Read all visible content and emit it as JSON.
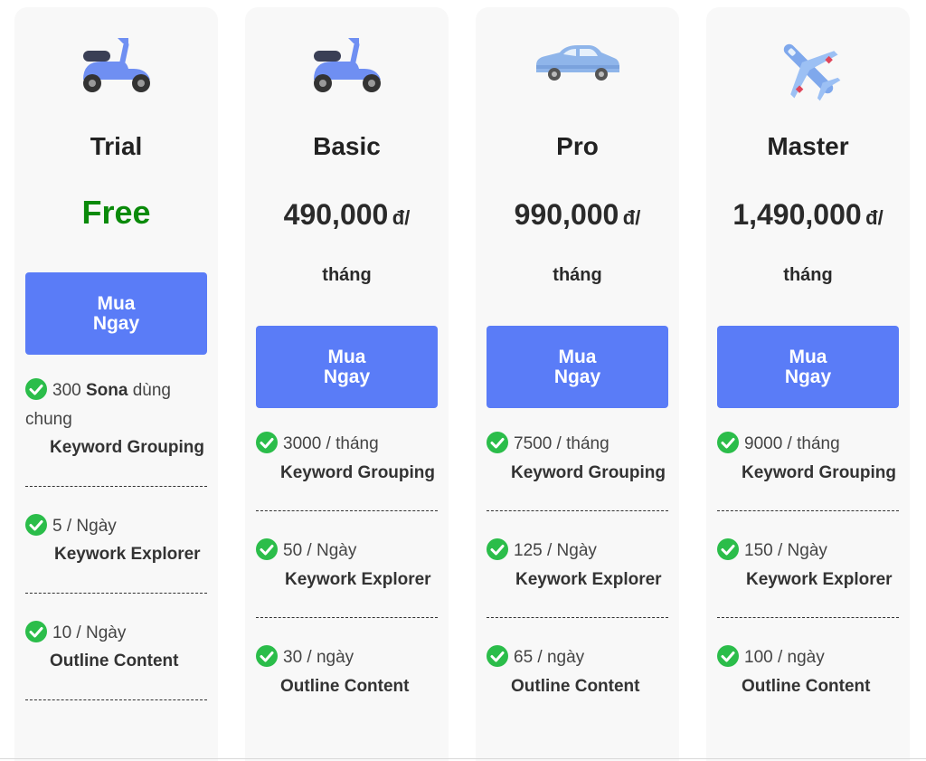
{
  "cards": [
    {
      "icon": "scooter-icon",
      "name": "Trial",
      "price_free": "Free",
      "buy_label": "Mua\nNgay",
      "features": [
        {
          "count": "300",
          "bold": "Sona",
          "suffix": "dùng chung",
          "feature": "Keyword Grouping"
        },
        {
          "count": "5 / Ngày",
          "feature": "Keywork Explorer"
        },
        {
          "count": "10 / Ngày",
          "feature": "Outline Content"
        }
      ]
    },
    {
      "icon": "scooter-icon",
      "name": "Basic",
      "price_amount": "490,000",
      "price_unit": "đ/",
      "period": "tháng",
      "buy_label": "Mua\nNgay",
      "features": [
        {
          "count": "3000 / tháng",
          "feature": "Keyword Grouping"
        },
        {
          "count": "50 / Ngày",
          "feature": "Keywork Explorer"
        },
        {
          "count": "30 / ngày",
          "feature": "Outline Content"
        }
      ]
    },
    {
      "icon": "car-icon",
      "name": "Pro",
      "price_amount": "990,000",
      "price_unit": "đ/",
      "period": "tháng",
      "buy_label": "Mua\nNgay",
      "features": [
        {
          "count": "7500 / tháng",
          "feature": "Keyword Grouping"
        },
        {
          "count": "125 / Ngày",
          "feature": "Keywork Explorer"
        },
        {
          "count": "65 / ngày",
          "feature": "Outline Content"
        }
      ]
    },
    {
      "icon": "airplane-icon",
      "name": "Master",
      "price_amount": "1,490,000",
      "price_unit": "đ/",
      "period": "tháng",
      "buy_label": "Mua\nNgay",
      "features": [
        {
          "count": "9000 / tháng",
          "feature": "Keyword Grouping"
        },
        {
          "count": "150 / Ngày",
          "feature": "Keywork Explorer"
        },
        {
          "count": "100 / ngày",
          "feature": "Outline Content"
        }
      ]
    }
  ],
  "colors": {
    "button": "#5a7cf7",
    "free": "#0a8a0a",
    "check": "#2bbd4a",
    "card_bg": "#f8f8f8"
  }
}
